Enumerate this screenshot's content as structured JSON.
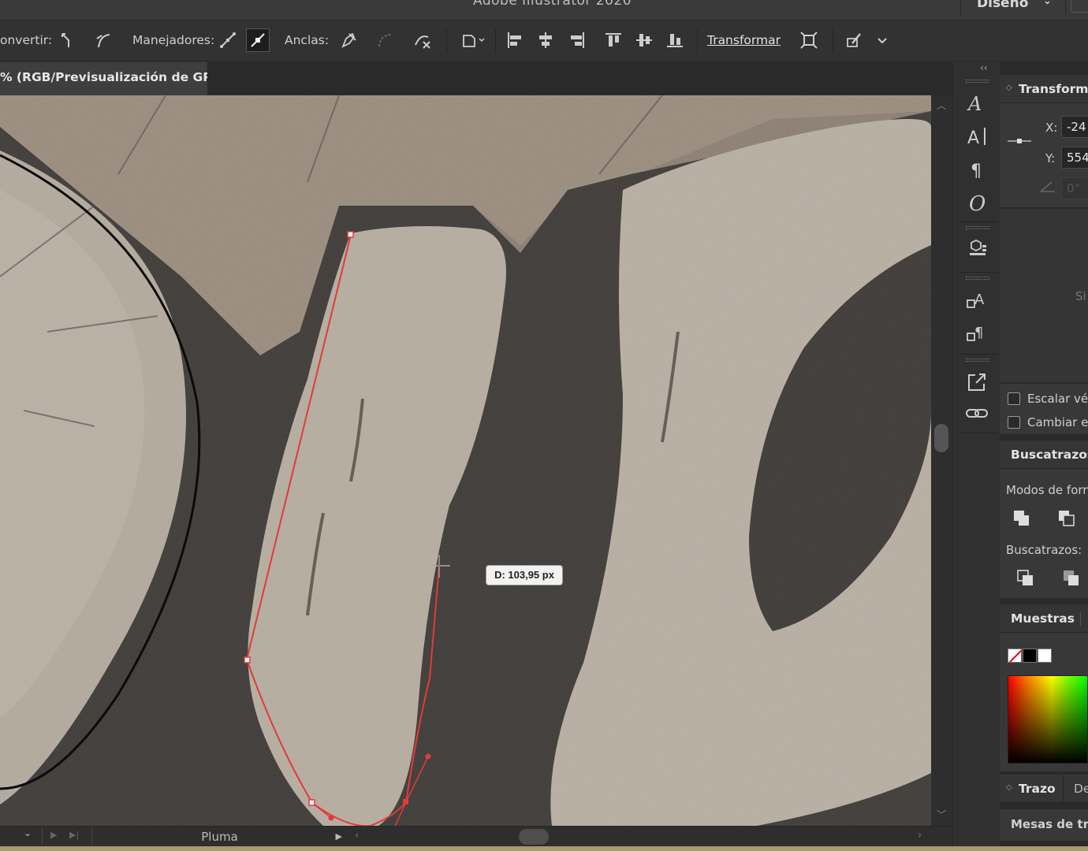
{
  "app": {
    "title": "Adobe Illustrator 2020",
    "workspace": "Diseño"
  },
  "controlbar": {
    "convert_label": "onvertir:",
    "handles_label": "Manejadores:",
    "anchors_label": "Anclas:",
    "transform_link": "Transformar"
  },
  "document": {
    "tab_title": "% (RGB/Previsualización de GPU)"
  },
  "canvas": {
    "measure_label": "D: 103,95 px"
  },
  "status": {
    "tool_name": "Pluma"
  },
  "panels": {
    "transform": {
      "title": "Transforma",
      "x_label": "X:",
      "x_value": "-24",
      "y_label": "Y:",
      "y_value": "554",
      "angle_value": "0°",
      "side_text": "Si"
    },
    "options": {
      "scale_strokes": "Escalar vér",
      "change": "Cambiar es"
    },
    "pathfinder": {
      "title": "Buscatrazos",
      "shape_modes": "Modos de forn",
      "pathfinders": "Buscatrazos:"
    },
    "swatches": {
      "title": "Muestras"
    },
    "stroke": {
      "title": "Trazo",
      "tab2": "De",
      "artboards": "Mesas de tra"
    }
  },
  "colors": {
    "path_red": "#e23a3a",
    "ui_bg": "#323232",
    "panel_bg": "#383838"
  }
}
